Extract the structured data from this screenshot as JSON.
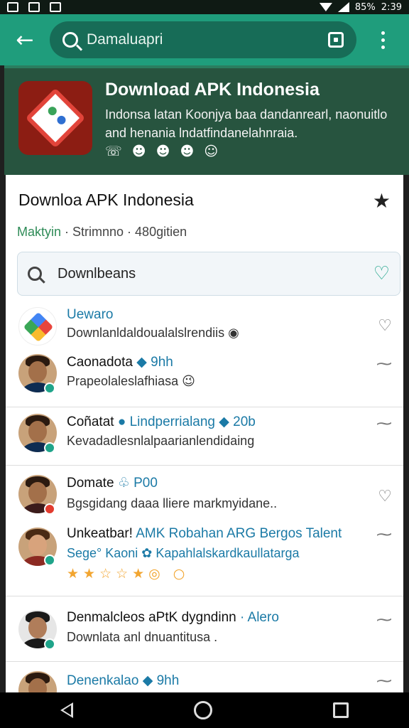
{
  "status_bar": {
    "battery": "85%",
    "time": "2:39"
  },
  "app_bar": {
    "search_query": "Damaluapri"
  },
  "banner": {
    "title": "Download APK Indonesia",
    "description": "Indonsa latan Koonjya baa dandanrearl, naonuitlo and henania lndatfindanelahnraia.",
    "emojis": "☏ ☻ ☻ ☻ ☺"
  },
  "card": {
    "title": "Downloa APK Indonesia",
    "subtitle_a": "Maktyin",
    "subtitle_b": "· Strimnno · 480gitien",
    "filter_text": "Downlbeans"
  },
  "items": [
    {
      "title": "Uewaro",
      "meta": "",
      "desc": "Downlanldaldoualalslrendiis ◉"
    },
    {
      "title": "Caonadota",
      "meta": "◆ 9hh",
      "desc": "Prapeolaleslafhiasa 😉"
    },
    {
      "title": "Coñatat",
      "meta": "● Lindperrialang ◆ 20b",
      "desc": "Kevadadlesnlalpaarianlendidaing"
    },
    {
      "title": "Domate",
      "meta": "♧ P00",
      "desc": "Bgsgidang daaa lliere markmyidane.."
    },
    {
      "title": "Unkeatbar!",
      "meta": "AMK Robahan ARG Bergos Talent",
      "desc": "Sege° Kaoni ✿ Kapahlalskardkaullatarga",
      "stars": "★★☆☆★◎ ○"
    },
    {
      "title": "Denmalcleos aPtK dygndinn",
      "meta": "· Alero",
      "desc": "Downlata anl dnuantitusa ."
    },
    {
      "title": "Denenkalao",
      "meta": "◆ 9hh",
      "desc": ""
    }
  ],
  "colors": {
    "accent": "#1f9d7c",
    "banner": "#27543f",
    "link": "#1b7aa6"
  }
}
